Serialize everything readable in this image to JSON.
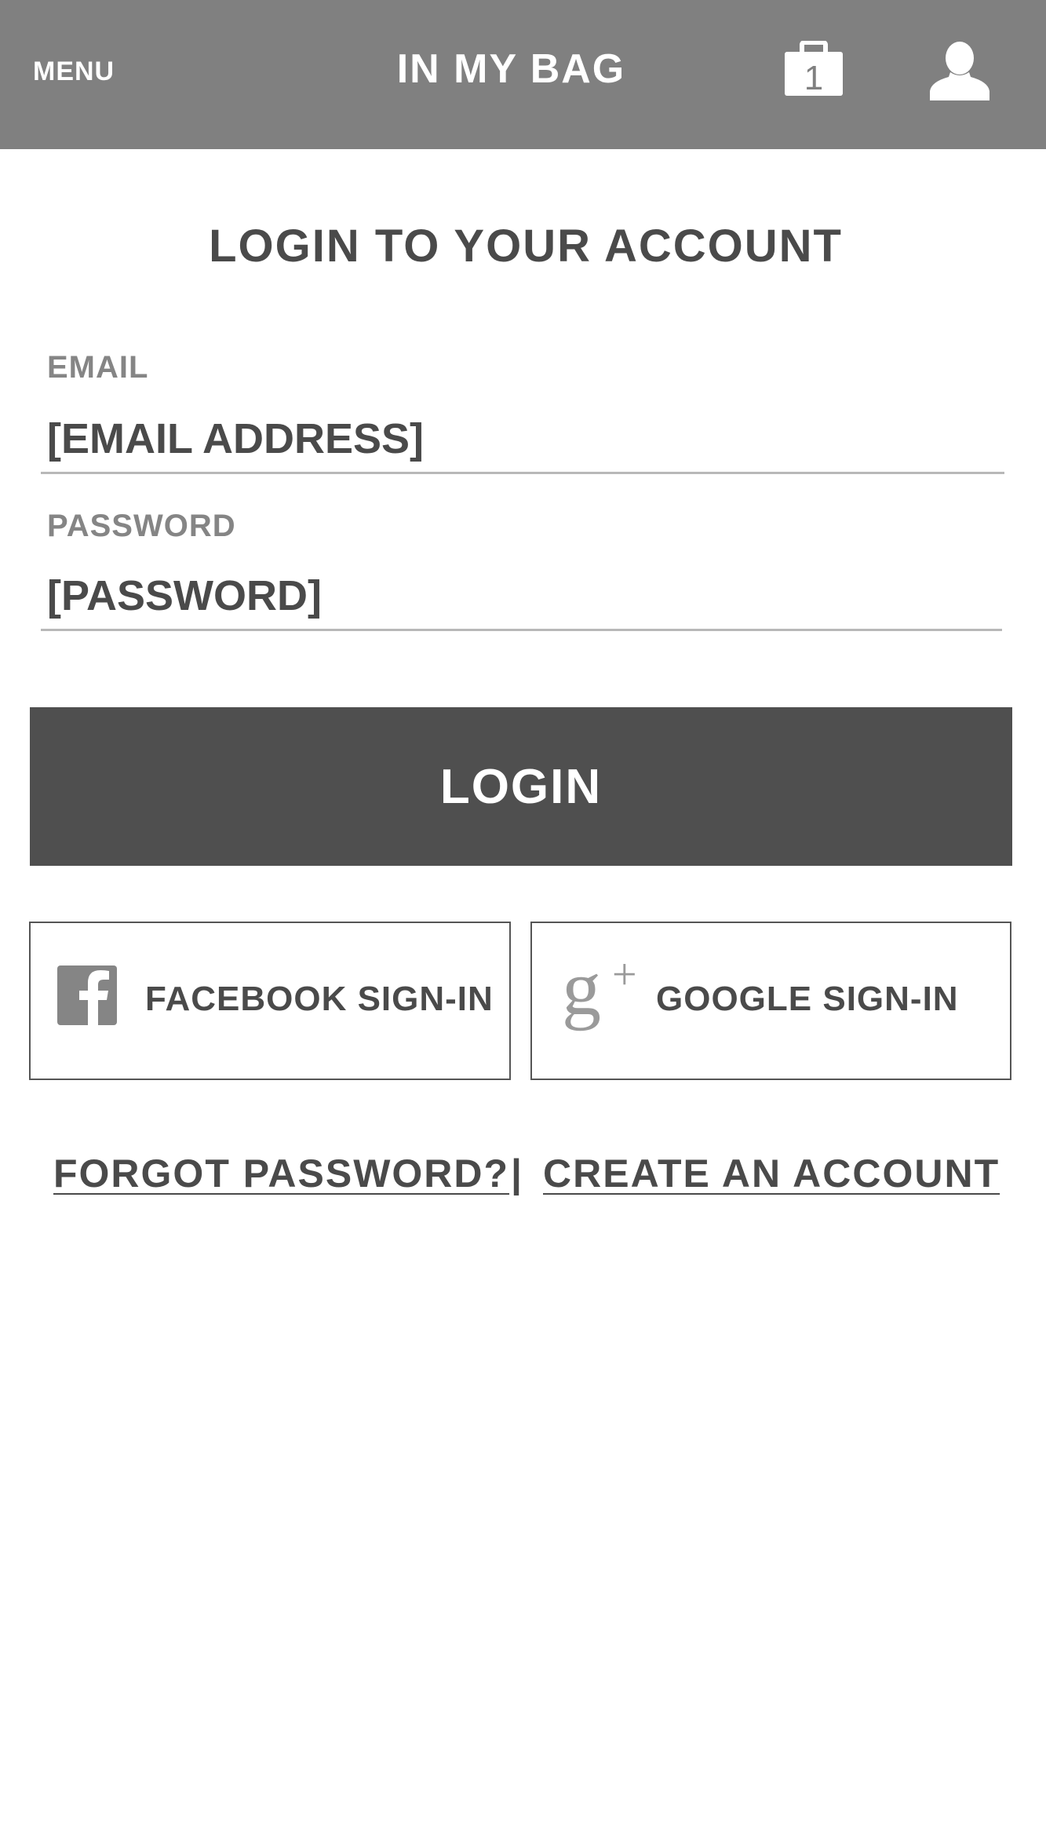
{
  "header": {
    "menu_label": "MENU",
    "title": "IN MY BAG",
    "bag_count": "1",
    "bag_icon": "shopping-bag-icon",
    "user_icon": "user-profile-icon",
    "background": "#808080"
  },
  "login": {
    "title": "LOGIN TO YOUR ACCOUNT",
    "email": {
      "label": "EMAIL",
      "placeholder": "[EMAIL ADDRESS]"
    },
    "password": {
      "label": "PASSWORD",
      "placeholder": "[PASSWORD]"
    },
    "submit_label": "LOGIN",
    "submit_color": "#4f4f4f"
  },
  "social": {
    "facebook": {
      "label": "FACEBOOK SIGN-IN",
      "icon": "facebook-icon"
    },
    "google": {
      "label": "GOOGLE SIGN-IN",
      "icon": "google-plus-icon"
    }
  },
  "links": {
    "forgot_password": "FORGOT PASSWORD?",
    "separator": "|",
    "create_account": "CREATE AN ACCOUNT"
  }
}
